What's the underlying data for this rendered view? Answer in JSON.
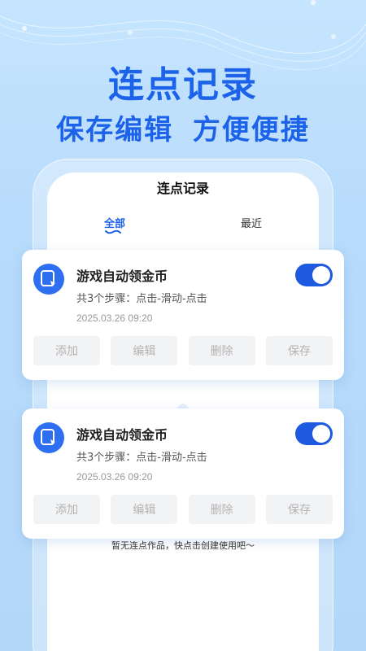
{
  "hero": {
    "title": "连点记录",
    "subtitle": "保存编辑 方便便捷"
  },
  "app": {
    "title": "连点记录",
    "tabs": [
      {
        "label": "全部",
        "active": true
      },
      {
        "label": "最近",
        "active": false
      }
    ]
  },
  "records": [
    {
      "name": "游戏自动领金币",
      "steps": "共3个步骤：点击-滑动-点击",
      "date": "2025.03.26 09:20",
      "enabled": true,
      "icon": "app-tap-icon",
      "buttons": [
        "添加",
        "编辑",
        "删除",
        "保存"
      ]
    },
    {
      "name": "游戏自动领金币",
      "steps": "共3个步骤：点击-滑动-点击",
      "date": "2025.03.26 09:20",
      "enabled": true,
      "icon": "app-tap-icon",
      "buttons": [
        "添加",
        "编辑",
        "删除",
        "保存"
      ]
    }
  ],
  "empty_tip": "暂无连点作品，快点击创建使用吧～",
  "colors": {
    "accent": "#1d63e9",
    "toggle_on": "#1d5ae0",
    "background": "#b9dcfb",
    "button_bg": "#f2f3f5",
    "button_text": "#b3b3b3"
  }
}
